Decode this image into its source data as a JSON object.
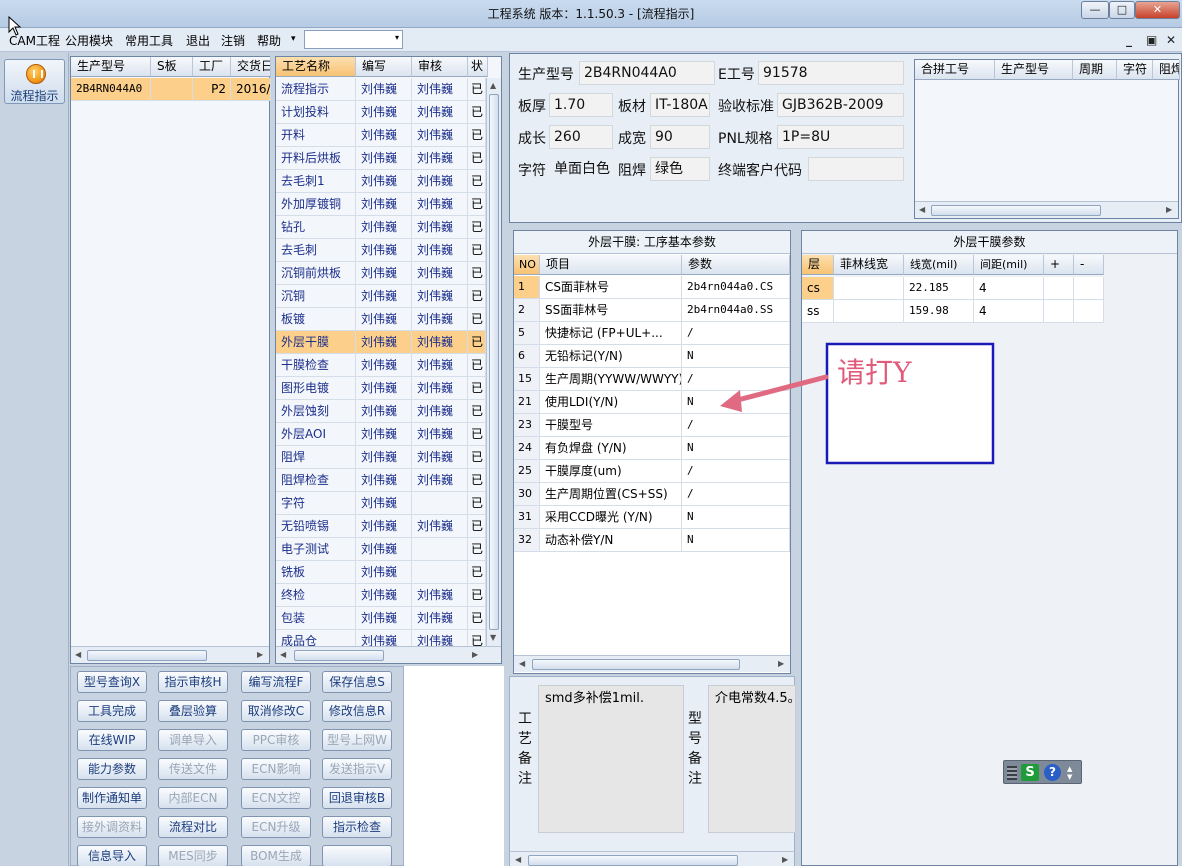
{
  "window": {
    "title": "工程系统   版本：1.1.50.3 - [流程指示]",
    "min": "—",
    "max": "□",
    "close": "✕"
  },
  "menubar": {
    "items": [
      "CAM工程",
      "公用模块",
      "常用工具",
      "退出",
      "注销",
      "帮助"
    ],
    "dropdown_arrow": "▾",
    "combo_value": "",
    "mdi_buttons": [
      "_",
      "▣",
      "✕"
    ]
  },
  "leftbar": {
    "flow_button": "流程指示"
  },
  "model_grid": {
    "headers": [
      "生产型号",
      "S板",
      "工厂",
      "交货日"
    ],
    "rows": [
      [
        "2B4RN044A0",
        "",
        "P2",
        "2016/"
      ]
    ]
  },
  "process_grid": {
    "headers": [
      "工艺名称",
      "编写",
      "审核",
      "状"
    ],
    "rows": [
      [
        "流程指示",
        "刘伟巍",
        "刘伟巍",
        "已"
      ],
      [
        "计划投料",
        "刘伟巍",
        "刘伟巍",
        "已"
      ],
      [
        "开料",
        "刘伟巍",
        "刘伟巍",
        "已"
      ],
      [
        "开料后烘板",
        "刘伟巍",
        "刘伟巍",
        "已"
      ],
      [
        "去毛刺1",
        "刘伟巍",
        "刘伟巍",
        "已"
      ],
      [
        "外加厚镀铜",
        "刘伟巍",
        "刘伟巍",
        "已"
      ],
      [
        "钻孔",
        "刘伟巍",
        "刘伟巍",
        "已"
      ],
      [
        "去毛刺",
        "刘伟巍",
        "刘伟巍",
        "已"
      ],
      [
        "沉铜前烘板",
        "刘伟巍",
        "刘伟巍",
        "已"
      ],
      [
        "沉铜",
        "刘伟巍",
        "刘伟巍",
        "已"
      ],
      [
        "板镀",
        "刘伟巍",
        "刘伟巍",
        "已"
      ],
      [
        "外层干膜",
        "刘伟巍",
        "刘伟巍",
        "已"
      ],
      [
        "干膜检查",
        "刘伟巍",
        "刘伟巍",
        "已"
      ],
      [
        "图形电镀",
        "刘伟巍",
        "刘伟巍",
        "已"
      ],
      [
        "外层蚀刻",
        "刘伟巍",
        "刘伟巍",
        "已"
      ],
      [
        "外层AOI",
        "刘伟巍",
        "刘伟巍",
        "已"
      ],
      [
        "阻焊",
        "刘伟巍",
        "刘伟巍",
        "已"
      ],
      [
        "阻焊检查",
        "刘伟巍",
        "刘伟巍",
        "已"
      ],
      [
        "字符",
        "刘伟巍",
        "",
        "已"
      ],
      [
        "无铅喷锡",
        "刘伟巍",
        "刘伟巍",
        "已"
      ],
      [
        "电子测试",
        "刘伟巍",
        "",
        "已"
      ],
      [
        "铣板",
        "刘伟巍",
        "",
        "已"
      ],
      [
        "终检",
        "刘伟巍",
        "刘伟巍",
        "已"
      ],
      [
        "包装",
        "刘伟巍",
        "刘伟巍",
        "已"
      ],
      [
        "成品仓",
        "刘伟巍",
        "刘伟巍",
        "已"
      ]
    ],
    "selected_index": 11
  },
  "info": {
    "prod_model_label": "生产型号",
    "prod_model": "2B4RN044A0",
    "e_no_label": "E工号",
    "e_no": "91578",
    "thickness_label": "板厚",
    "thickness": "1.70",
    "material_label": "板材",
    "material": "IT-180A",
    "standard_label": "验收标准",
    "standard": "GJB362B-2009",
    "length_label": "成长",
    "length": "260",
    "width_label": "成宽",
    "width": "90",
    "pnl_label": "PNL规格",
    "pnl": "1P=8U",
    "char_label": "字符",
    "char": "单面白色",
    "mask_label": "阻焊",
    "mask": "绿色",
    "customer_code_label": "终端客户代码",
    "customer_code": ""
  },
  "combine_grid": {
    "headers": [
      "合拼工号",
      "生产型号",
      "周期",
      "字符",
      "阻焊"
    ]
  },
  "params_panel": {
    "caption": "外层干膜: 工序基本参数",
    "headers": [
      "NO",
      "项目",
      "参数"
    ],
    "rows": [
      [
        "1",
        "CS面菲林号",
        "2b4rn044a0.CS"
      ],
      [
        "2",
        "SS面菲林号",
        "2b4rn044a0.SS"
      ],
      [
        "5",
        "快捷标记 (FP+UL+...",
        "/"
      ],
      [
        "6",
        "无铅标记(Y/N)",
        "N"
      ],
      [
        "15",
        "生产周期(YYWW/WWYY)",
        "/"
      ],
      [
        "21",
        "使用LDI(Y/N)",
        "N"
      ],
      [
        "23",
        "干膜型号",
        "/"
      ],
      [
        "24",
        "有负焊盘 (Y/N)",
        "N"
      ],
      [
        "25",
        "干膜厚度(um)",
        "/"
      ],
      [
        "30",
        "生产周期位置(CS+SS)",
        "/"
      ],
      [
        "31",
        "采用CCD曝光 (Y/N)",
        "N"
      ],
      [
        "32",
        "动态补偿Y/N",
        "N"
      ]
    ]
  },
  "film_panel": {
    "caption": "外层干膜参数",
    "headers": [
      "层",
      "菲林线宽",
      "线宽(mil)",
      "间距(mil)",
      "+",
      "-"
    ],
    "rows": [
      [
        "cs",
        "",
        "22.185",
        "4",
        "",
        ""
      ],
      [
        "ss",
        "",
        "159.98",
        "4",
        "",
        ""
      ]
    ]
  },
  "annotation": {
    "text": "请打Y",
    "color": "#e05a7a"
  },
  "buttons": [
    {
      "label": "型号查询X",
      "enabled": true
    },
    {
      "label": "指示审核H",
      "enabled": true
    },
    {
      "label": "编写流程F",
      "enabled": true
    },
    {
      "label": "保存信息S",
      "enabled": true
    },
    {
      "label": "工具完成",
      "enabled": true
    },
    {
      "label": "叠层验算",
      "enabled": true
    },
    {
      "label": "取消修改C",
      "enabled": true
    },
    {
      "label": "修改信息R",
      "enabled": true
    },
    {
      "label": "在线WIP",
      "enabled": true
    },
    {
      "label": "调单导入",
      "enabled": false
    },
    {
      "label": "PPC审核",
      "enabled": false
    },
    {
      "label": "型号上网W",
      "enabled": false
    },
    {
      "label": "能力参数",
      "enabled": true
    },
    {
      "label": "传送文件",
      "enabled": false
    },
    {
      "label": "ECN影响",
      "enabled": false
    },
    {
      "label": "发送指示V",
      "enabled": false
    },
    {
      "label": "制作通知单",
      "enabled": true
    },
    {
      "label": "内部ECN",
      "enabled": false
    },
    {
      "label": "ECN文控",
      "enabled": false
    },
    {
      "label": "回退审核B",
      "enabled": true
    },
    {
      "label": "接外调资料",
      "enabled": false
    },
    {
      "label": "流程对比",
      "enabled": true
    },
    {
      "label": "ECN升级",
      "enabled": false
    },
    {
      "label": "指示检查",
      "enabled": true
    },
    {
      "label": "信息导入",
      "enabled": true
    },
    {
      "label": "MES同步",
      "enabled": false
    },
    {
      "label": "BOM生成",
      "enabled": false
    },
    {
      "label": "",
      "enabled": true
    }
  ],
  "notes": {
    "process_label": "工艺备注",
    "process_note": "smd多补偿1mil.",
    "model_label": "型号备注",
    "model_note": "介电常数4.5。"
  },
  "ime_toolbar": {
    "s_icon": "S",
    "help_icon": "?"
  }
}
